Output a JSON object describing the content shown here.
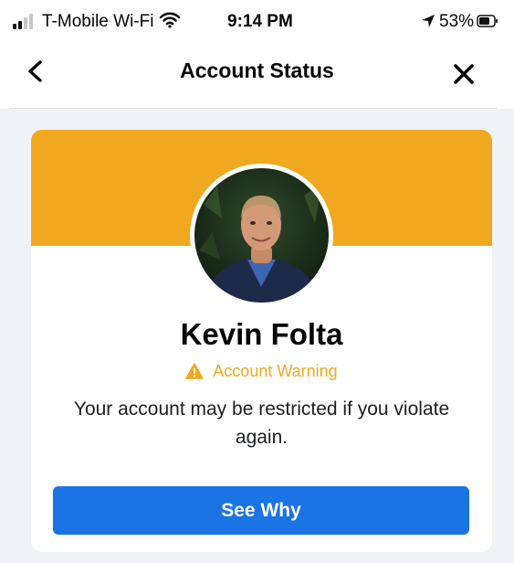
{
  "status_bar": {
    "carrier": "T-Mobile Wi-Fi",
    "time": "9:14 PM",
    "battery_percent": "53%",
    "signal_bars": 2,
    "icons": [
      "signal-icon",
      "wifi-icon",
      "location-arrow-icon",
      "battery-icon"
    ]
  },
  "nav": {
    "title": "Account Status",
    "back_icon": "chevron-left-icon",
    "close_icon": "close-icon"
  },
  "card": {
    "banner_color": "#f0a820",
    "profile_name": "Kevin Folta",
    "warning_label": "Account Warning",
    "warning_icon": "warning-triangle-icon",
    "message": "Your account may be restricted if you violate again.",
    "button_label": "See Why",
    "button_color": "#1b74e4"
  },
  "colors": {
    "background": "#f0f2f5",
    "warning": "#f0a820",
    "primary": "#1b74e4"
  }
}
